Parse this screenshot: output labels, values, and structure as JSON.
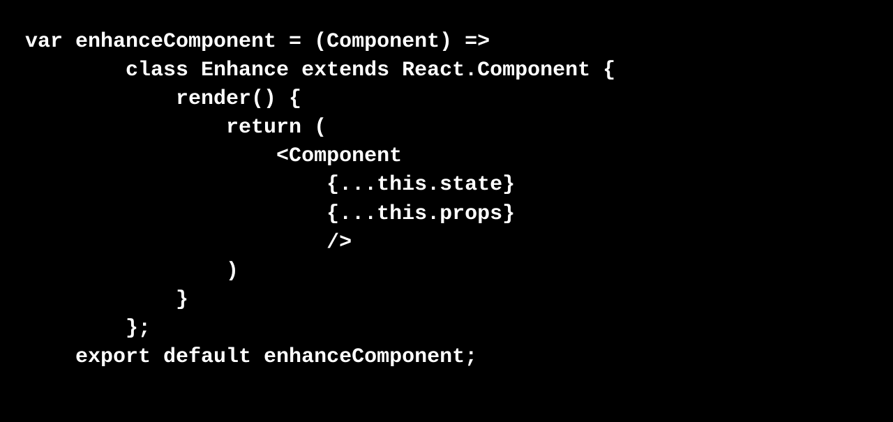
{
  "code": {
    "lines": [
      "var enhanceComponent = (Component) =>",
      "        class Enhance extends React.Component {",
      "            render() {",
      "                return (",
      "                    <Component",
      "                        {...this.state}",
      "                        {...this.props}",
      "                        />",
      "                )",
      "            }",
      "        };",
      "",
      "    export default enhanceComponent;"
    ]
  }
}
